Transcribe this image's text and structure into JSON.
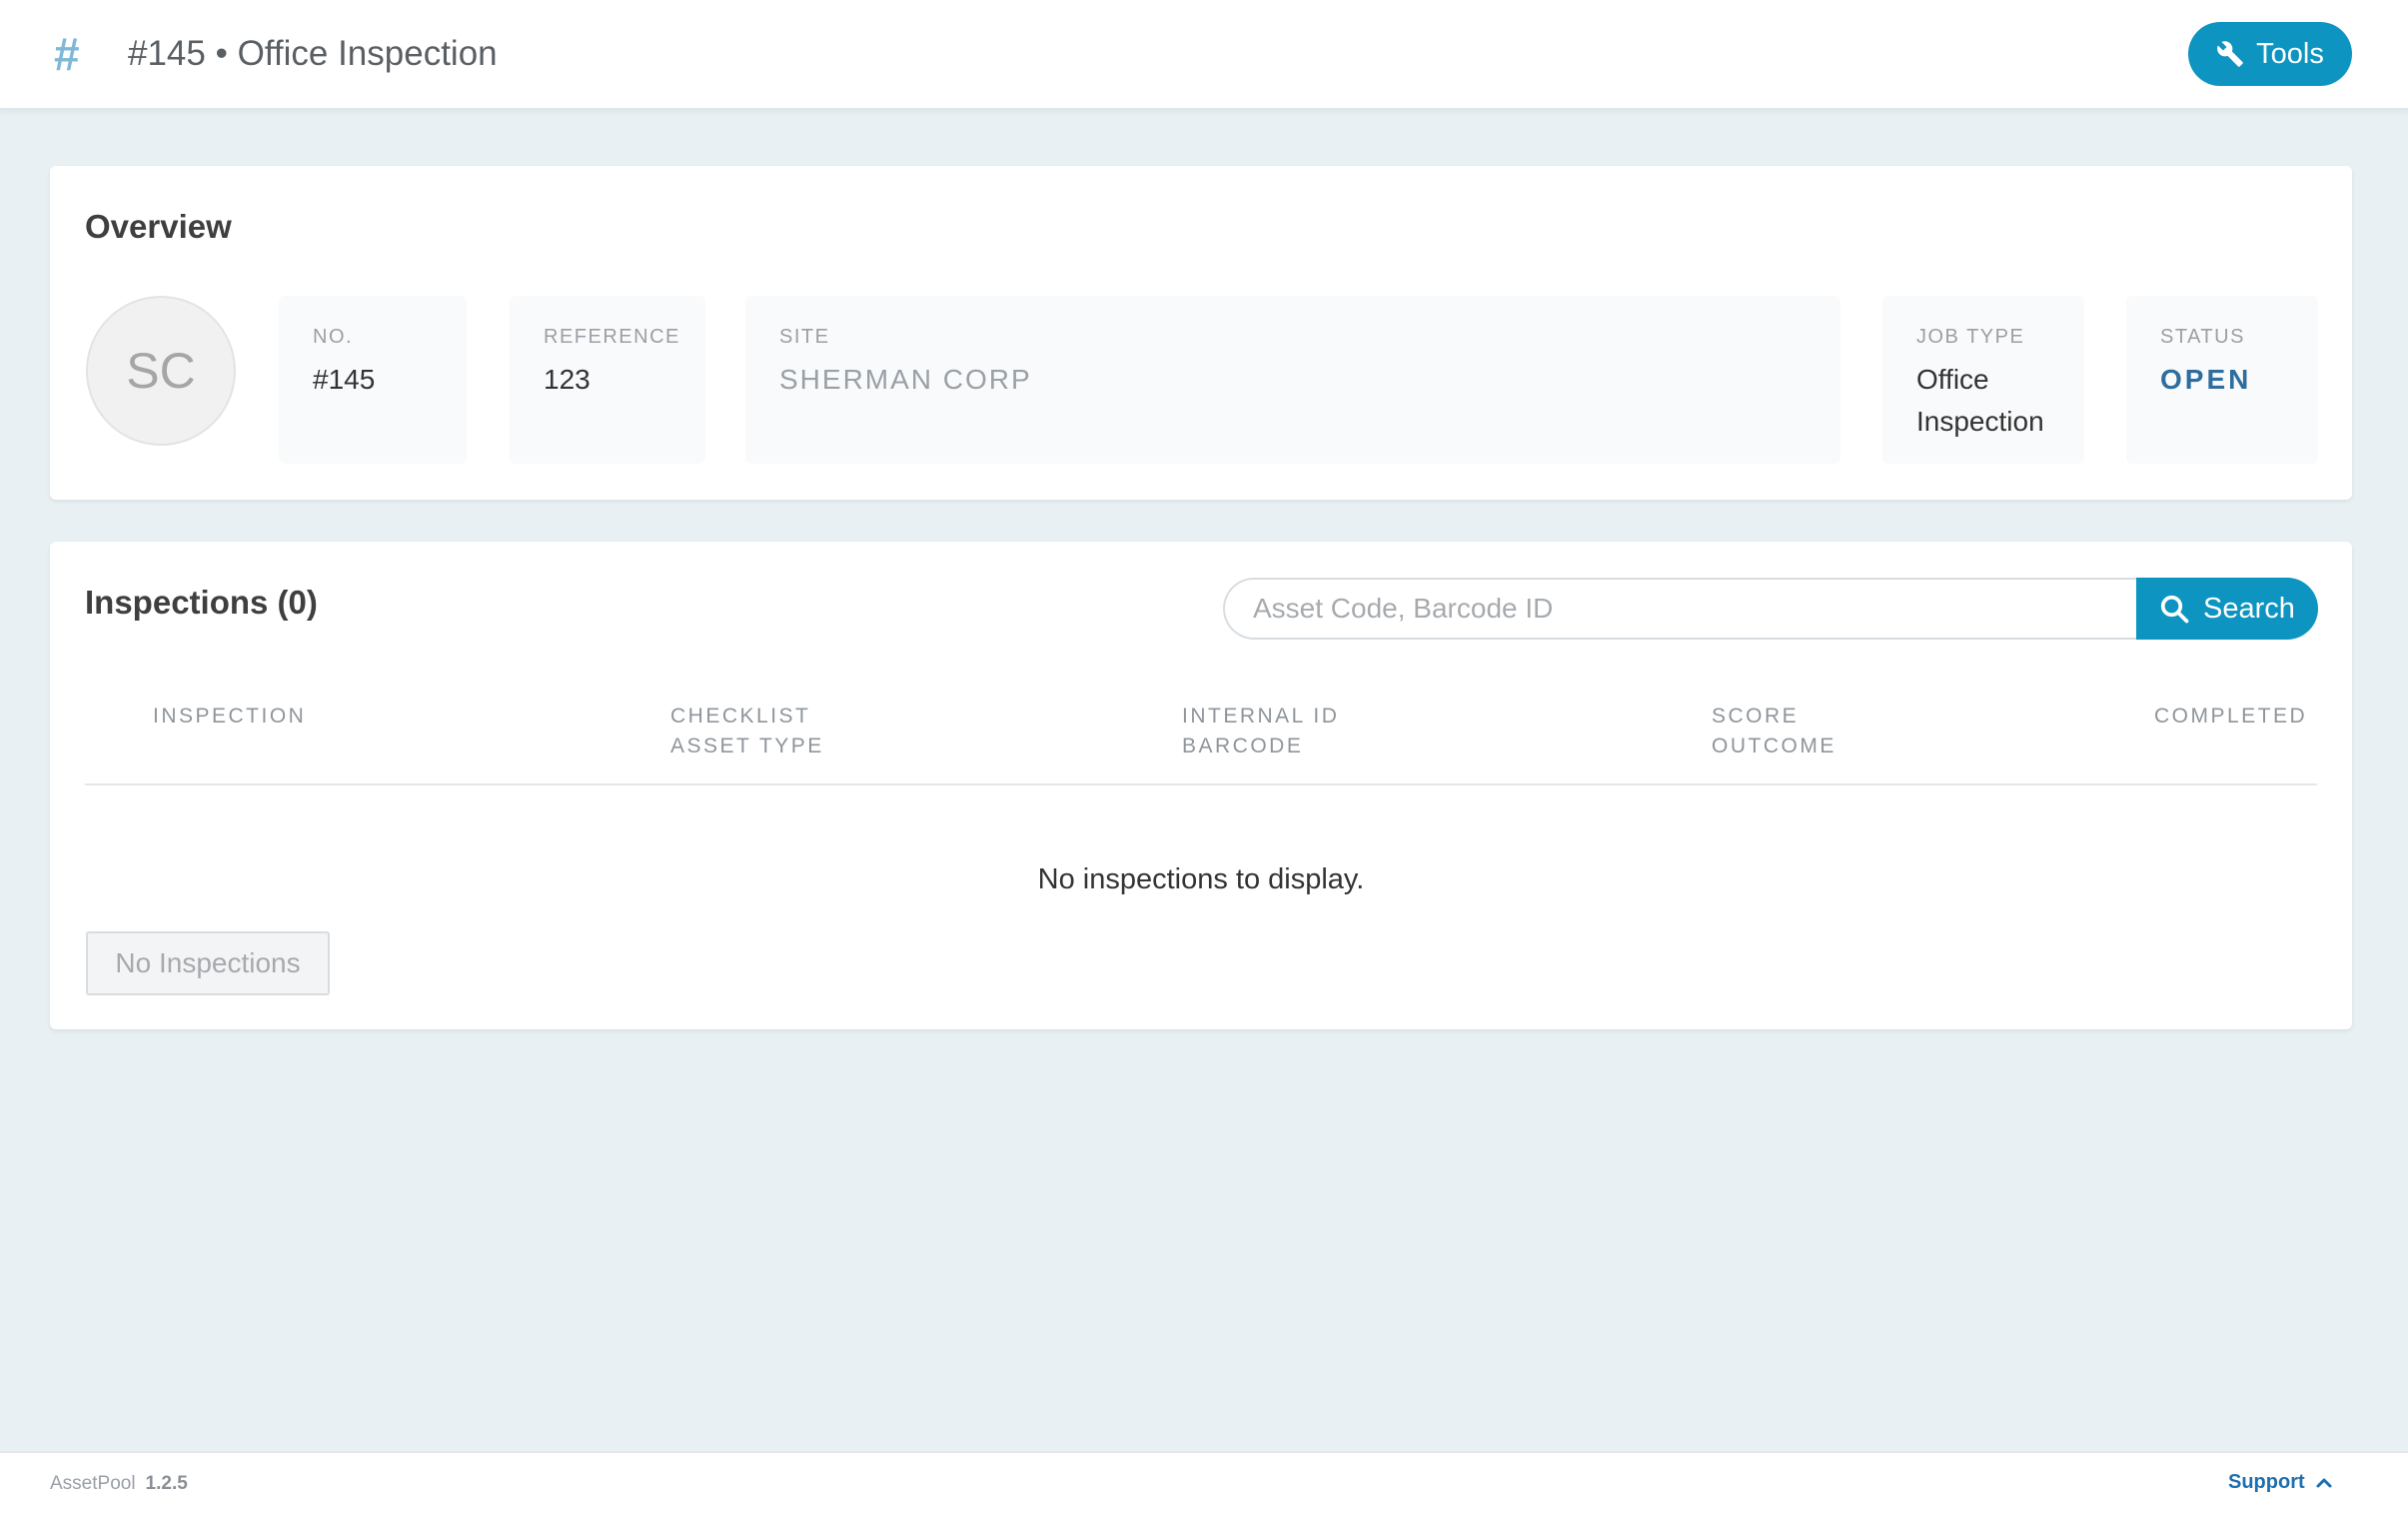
{
  "header": {
    "title": "#145 • Office Inspection",
    "tools_label": "Tools",
    "icons": {
      "title": "hash-icon",
      "tools": "wrench-icon"
    }
  },
  "overview": {
    "title": "Overview",
    "avatar_initials": "SC",
    "fields": {
      "no": {
        "label": "NO.",
        "value": "#145"
      },
      "reference": {
        "label": "REFERENCE",
        "value": "123"
      },
      "site": {
        "label": "SITE",
        "value": "SHERMAN CORP"
      },
      "job_type": {
        "label": "JOB TYPE",
        "value_line1": "Office",
        "value_line2": "Inspection"
      },
      "status": {
        "label": "STATUS",
        "value": "OPEN"
      }
    }
  },
  "inspections": {
    "title": "Inspections (0)",
    "search": {
      "placeholder": "Asset Code, Barcode ID",
      "value": "",
      "button_label": "Search"
    },
    "columns": [
      {
        "line1": "INSPECTION",
        "line2": ""
      },
      {
        "line1": "CHECKLIST",
        "line2": "ASSET TYPE"
      },
      {
        "line1": "INTERNAL ID",
        "line2": "BARCODE"
      },
      {
        "line1": "SCORE",
        "line2": "OUTCOME"
      },
      {
        "line1": "COMPLETED",
        "line2": ""
      }
    ],
    "empty_message": "No inspections to display.",
    "no_inspections_button": "No Inspections"
  },
  "footer": {
    "app_name": "AssetPool",
    "version": "1.2.5",
    "support_label": "Support"
  },
  "colors": {
    "accent": "#0e94c1",
    "status": "#2d6e9e",
    "background": "#e8f0f3",
    "link": "#1c6fb0"
  }
}
